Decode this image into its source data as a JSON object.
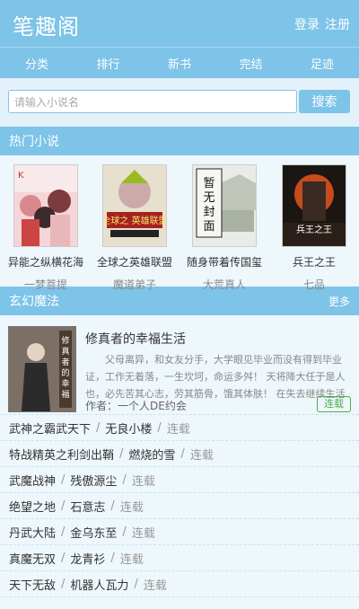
{
  "header": {
    "logo": "笔趣阁",
    "login": "登录",
    "register": "注册"
  },
  "nav": [
    "分类",
    "排行",
    "新书",
    "完结",
    "足迹"
  ],
  "search": {
    "placeholder": "请输入小说名",
    "button": "搜索"
  },
  "hot": {
    "title": "热门小说",
    "items": [
      {
        "title": "异能之纵横花海",
        "author": "一梦菩提"
      },
      {
        "title": "全球之英雄联盟",
        "author": "魔道弟子",
        "cover_text": "全球之 英雄联盟"
      },
      {
        "title": "随身带着传国玺",
        "author": "大荒真人",
        "cover_text": "暂无封面"
      },
      {
        "title": "兵王之王",
        "author": "七品",
        "cover_text": "兵王之王"
      }
    ]
  },
  "fantasy": {
    "title": "玄幻魔法",
    "more": "更多",
    "featured": {
      "title": "修真者的幸福生活",
      "desc": "父母离异，和女友分手，大学眼见毕业而没有得到毕业证，工作无着落，一生坎坷，命运多舛！ 天将降大任于是人也，必先苦其心志，劳其筋骨，饿其体肤！ 在失去继续生活",
      "author_label": "作者：",
      "author": "一个人DE约会",
      "status": "连载",
      "cover_text": "修真者的幸福生活"
    },
    "list": [
      {
        "title": "武神之霸武天下",
        "author": "无良小楼",
        "status": "连载"
      },
      {
        "title": "特战精英之利剑出鞘",
        "author": "燃烧的雪",
        "status": "连载"
      },
      {
        "title": "武魔战神",
        "author": "残傲源尘",
        "status": "连载"
      },
      {
        "title": "绝望之地",
        "author": "石意志",
        "status": "连载"
      },
      {
        "title": "丹武大陆",
        "author": "金乌东至",
        "status": "连载"
      },
      {
        "title": "真魔无双",
        "author": "龙青衫",
        "status": "连载"
      },
      {
        "title": "天下无敌",
        "author": "机器人瓦力",
        "status": "连载"
      }
    ]
  }
}
